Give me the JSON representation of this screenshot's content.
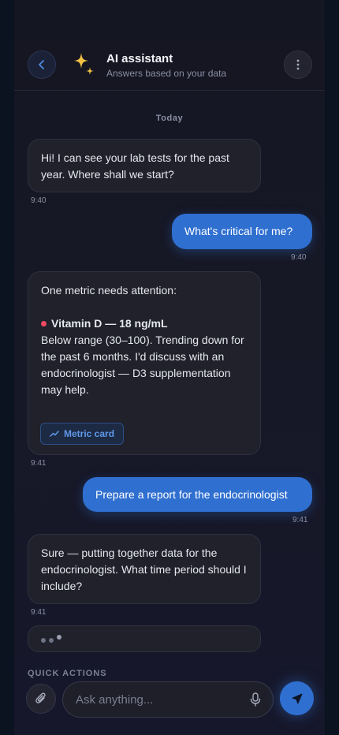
{
  "header": {
    "title": "AI assistant",
    "subtitle": "Answers based on your data"
  },
  "date_separator": "Today",
  "messages": [
    {
      "from": "assistant",
      "text": "Hi! I can see your lab tests for the past year. Where shall we start?",
      "time": "9:40"
    },
    {
      "from": "user",
      "text": "What's critical for me?",
      "time": "9:40"
    },
    {
      "from": "assistant",
      "intro": "One metric needs attention:",
      "metric_title": "Vitamin D — 18 ng/mL",
      "metric_status_color": "#ef4a64",
      "body": "Below range (30–100). Trending down for the past 6 months. I'd discuss with an endocrinologist — D3 supplementation may help.",
      "button_label": "Metric card",
      "time": "9:41"
    },
    {
      "from": "user",
      "text": "Prepare a report for the endocrinologist",
      "time": "9:41"
    },
    {
      "from": "assistant",
      "text": "Sure — putting together data for the endocrinologist. What time period should I include?",
      "time": "9:41"
    }
  ],
  "quick_actions_label": "QUICK ACTIONS",
  "composer": {
    "placeholder": "Ask anything..."
  },
  "icons": {
    "back": "chevron-left-icon",
    "assistant": "sparkles-icon",
    "more": "more-vertical-icon",
    "metric": "trend-line-icon",
    "attach": "paperclip-icon",
    "mic": "microphone-icon",
    "send": "send-icon"
  },
  "colors": {
    "accent": "#2f6fd0",
    "sparkle": "#f3c244",
    "alert": "#ef4a64"
  }
}
